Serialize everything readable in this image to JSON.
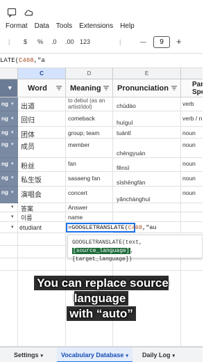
{
  "menu": {
    "format": "Format",
    "data": "Data",
    "tools": "Tools",
    "extensions": "Extensions",
    "help": "Help"
  },
  "toolbar": {
    "currency": "$",
    "percent": "%",
    "decrease_decimal": ".0",
    "increase_decimal": ".00",
    "number_format": "123",
    "minus": "—",
    "font_size": "9",
    "plus": "+"
  },
  "formula_bar": {
    "prefix": "LATE(",
    "ref": "C468",
    "suffix": ",\"a"
  },
  "columns": {
    "c": "C",
    "d": "D",
    "e": "E"
  },
  "headers": {
    "word": "Word",
    "meaning": "Meaning",
    "pronunciation": "Pronunciation",
    "part_of_speech_top": "Par",
    "part_of_speech_bottom": "Spe"
  },
  "rows": [
    {
      "tag": "ng",
      "word": "出道",
      "meaning": "to debut (as an artist/idol)",
      "pron": "chūdào",
      "pos": "verb"
    },
    {
      "tag": "ng",
      "word": "回归",
      "meaning": "comeback",
      "pron": "huíguī",
      "pos": "verb / n"
    },
    {
      "tag": "ng",
      "word": "团体",
      "meaning": "group; team",
      "pron": "tuántǐ",
      "pos": "noun"
    },
    {
      "tag": "ng",
      "word": "成员",
      "meaning": "member",
      "pron": "chéngyuán",
      "pos": "noun"
    },
    {
      "tag": "ng",
      "word": "粉丝",
      "meaning": "fan",
      "pron": "fěnsī",
      "pos": "noun"
    },
    {
      "tag": "ng",
      "word": "私生饭",
      "meaning": "sasaeng fan",
      "pron": "sīshēngfàn",
      "pos": "noun"
    },
    {
      "tag": "ng",
      "word": "演唱会",
      "meaning": "concert",
      "pron": "yǎnchànghuì",
      "pos": "noun"
    },
    {
      "tag": "",
      "word": "答案",
      "meaning": "Answer",
      "pron": "",
      "pos": ""
    },
    {
      "tag": "",
      "word": "이름",
      "meaning": "name",
      "pron": "",
      "pos": ""
    },
    {
      "tag": "",
      "word": "étudiant",
      "meaning": "",
      "pron": "",
      "pos": ""
    }
  ],
  "active_cell": {
    "prefix": "=GOOGLETRANSLATE(",
    "ref": "C468",
    "suffix": ",\"au"
  },
  "popup": {
    "fn": "GOOGLETRANSLATE(text, ",
    "highlight": "[source_language]",
    "after": ",",
    "line2": "[target_language])"
  },
  "caption": {
    "line1": "You can replace source language",
    "line2": "with “auto”"
  },
  "tabs": {
    "settings": "Settings",
    "vocabulary": "Vocabulary Database",
    "daily": "Daily Log"
  }
}
